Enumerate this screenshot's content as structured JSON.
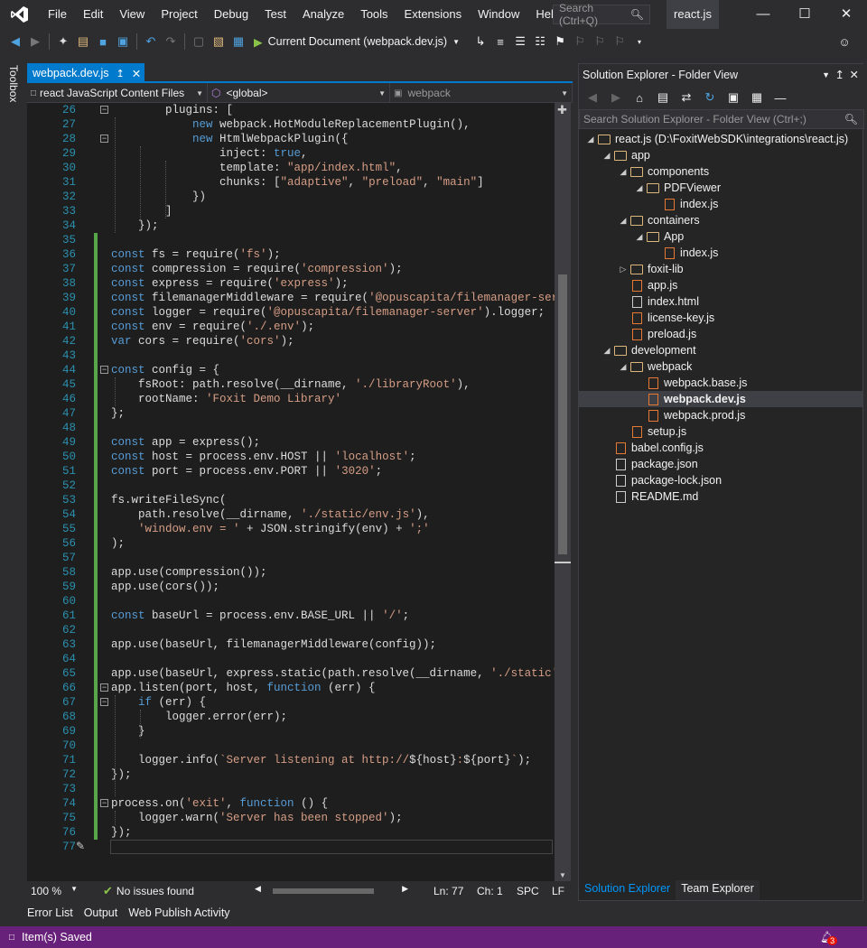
{
  "menu": {
    "items": [
      "File",
      "Edit",
      "View",
      "Project",
      "Debug",
      "Test",
      "Analyze",
      "Tools",
      "Extensions",
      "Window",
      "Help"
    ],
    "search_placeholder": "Search (Ctrl+Q)",
    "project_title": "react.js"
  },
  "toolbar": {
    "run_label": "Current Document (webpack.dev.js)"
  },
  "toolbox_label": "Toolbox",
  "editor": {
    "tab_label": "webpack.dev.js",
    "nav_project": "react JavaScript Content Files",
    "nav_scope": "<global>",
    "nav_member": "webpack",
    "lines": [
      {
        "n": "26",
        "t": "        plugins: ["
      },
      {
        "n": "27",
        "t": "            new webpack.HotModuleReplacementPlugin(),"
      },
      {
        "n": "28",
        "t": "            new HtmlWebpackPlugin({"
      },
      {
        "n": "29",
        "t": "                inject: true,"
      },
      {
        "n": "30",
        "t": "                template: \"app/index.html\","
      },
      {
        "n": "31",
        "t": "                chunks: [\"adaptive\", \"preload\", \"main\"]"
      },
      {
        "n": "32",
        "t": "            })"
      },
      {
        "n": "33",
        "t": "        ]"
      },
      {
        "n": "34",
        "t": "    });"
      },
      {
        "n": "35",
        "t": ""
      },
      {
        "n": "36",
        "t": "const fs = require('fs');"
      },
      {
        "n": "37",
        "t": "const compression = require('compression');"
      },
      {
        "n": "38",
        "t": "const express = require('express');"
      },
      {
        "n": "39",
        "t": "const filemanagerMiddleware = require('@opuscapita/filemanager-server'"
      },
      {
        "n": "40",
        "t": "const logger = require('@opuscapita/filemanager-server').logger;"
      },
      {
        "n": "41",
        "t": "const env = require('./.env');"
      },
      {
        "n": "42",
        "t": "var cors = require('cors');"
      },
      {
        "n": "43",
        "t": ""
      },
      {
        "n": "44",
        "t": "const config = {"
      },
      {
        "n": "45",
        "t": "    fsRoot: path.resolve(__dirname, './libraryRoot'),"
      },
      {
        "n": "46",
        "t": "    rootName: 'Foxit Demo Library'"
      },
      {
        "n": "47",
        "t": "};"
      },
      {
        "n": "48",
        "t": ""
      },
      {
        "n": "49",
        "t": "const app = express();"
      },
      {
        "n": "50",
        "t": "const host = process.env.HOST || 'localhost';"
      },
      {
        "n": "51",
        "t": "const port = process.env.PORT || '3020';"
      },
      {
        "n": "52",
        "t": ""
      },
      {
        "n": "53",
        "t": "fs.writeFileSync("
      },
      {
        "n": "54",
        "t": "    path.resolve(__dirname, './static/env.js'),"
      },
      {
        "n": "55",
        "t": "    'window.env = ' + JSON.stringify(env) + ';'"
      },
      {
        "n": "56",
        "t": ");"
      },
      {
        "n": "57",
        "t": ""
      },
      {
        "n": "58",
        "t": "app.use(compression());"
      },
      {
        "n": "59",
        "t": "app.use(cors());"
      },
      {
        "n": "60",
        "t": ""
      },
      {
        "n": "61",
        "t": "const baseUrl = process.env.BASE_URL || '/';"
      },
      {
        "n": "62",
        "t": ""
      },
      {
        "n": "63",
        "t": "app.use(baseUrl, filemanagerMiddleware(config));"
      },
      {
        "n": "64",
        "t": ""
      },
      {
        "n": "65",
        "t": "app.use(baseUrl, express.static(path.resolve(__dirname, './static')));"
      },
      {
        "n": "66",
        "t": "app.listen(port, host, function (err) {"
      },
      {
        "n": "67",
        "t": "    if (err) {"
      },
      {
        "n": "68",
        "t": "        logger.error(err);"
      },
      {
        "n": "69",
        "t": "    }"
      },
      {
        "n": "70",
        "t": ""
      },
      {
        "n": "71",
        "t": "    logger.info(`Server listening at http://${host}:${port}`);"
      },
      {
        "n": "72",
        "t": "});"
      },
      {
        "n": "73",
        "t": ""
      },
      {
        "n": "74",
        "t": "process.on('exit', function () {"
      },
      {
        "n": "75",
        "t": "    logger.warn('Server has been stopped');"
      },
      {
        "n": "76",
        "t": "});"
      },
      {
        "n": "77",
        "t": ""
      }
    ],
    "zoom": "100 %",
    "issues": "No issues found",
    "ln": "Ln: 77",
    "ch": "Ch: 1",
    "spc": "SPC",
    "lf": "LF"
  },
  "bottom_tabs": [
    "Error List",
    "Output",
    "Web Publish Activity"
  ],
  "status": {
    "message": "Item(s) Saved",
    "notif_count": "3"
  },
  "solution_explorer": {
    "title": "Solution Explorer - Folder View",
    "search_placeholder": "Search Solution Explorer - Folder View (Ctrl+;)",
    "nodes": [
      {
        "label": "react.js (D:\\FoxitWebSDK\\integrations\\react.js)",
        "level": 0,
        "exp": "open",
        "type": "folder"
      },
      {
        "label": "app",
        "level": 1,
        "exp": "open",
        "type": "folder"
      },
      {
        "label": "components",
        "level": 2,
        "exp": "open",
        "type": "folder"
      },
      {
        "label": "PDFViewer",
        "level": 3,
        "exp": "open",
        "type": "folder"
      },
      {
        "label": "index.js",
        "level": 4,
        "exp": "",
        "type": "js"
      },
      {
        "label": "containers",
        "level": 2,
        "exp": "open",
        "type": "folder"
      },
      {
        "label": "App",
        "level": 3,
        "exp": "open",
        "type": "folder"
      },
      {
        "label": "index.js",
        "level": 4,
        "exp": "",
        "type": "js"
      },
      {
        "label": "foxit-lib",
        "level": 2,
        "exp": "closed",
        "type": "folder"
      },
      {
        "label": "app.js",
        "level": 2,
        "exp": "",
        "type": "js"
      },
      {
        "label": "index.html",
        "level": 2,
        "exp": "",
        "type": "html"
      },
      {
        "label": "license-key.js",
        "level": 2,
        "exp": "",
        "type": "js"
      },
      {
        "label": "preload.js",
        "level": 2,
        "exp": "",
        "type": "js"
      },
      {
        "label": "development",
        "level": 1,
        "exp": "open",
        "type": "folder"
      },
      {
        "label": "webpack",
        "level": 2,
        "exp": "open",
        "type": "folder"
      },
      {
        "label": "webpack.base.js",
        "level": 3,
        "exp": "",
        "type": "js"
      },
      {
        "label": "webpack.dev.js",
        "level": 3,
        "exp": "",
        "type": "js",
        "selected": true
      },
      {
        "label": "webpack.prod.js",
        "level": 3,
        "exp": "",
        "type": "js"
      },
      {
        "label": "setup.js",
        "level": 2,
        "exp": "",
        "type": "js"
      },
      {
        "label": "babel.config.js",
        "level": 1,
        "exp": "",
        "type": "js"
      },
      {
        "label": "package.json",
        "level": 1,
        "exp": "",
        "type": "json"
      },
      {
        "label": "package-lock.json",
        "level": 1,
        "exp": "",
        "type": "json"
      },
      {
        "label": "README.md",
        "level": 1,
        "exp": "",
        "type": "md"
      }
    ],
    "tabs": [
      "Solution Explorer",
      "Team Explorer"
    ]
  },
  "colors": {
    "accent": "#007acc",
    "status_bar": "#68217a",
    "keyword": "#569cd6",
    "string": "#d69d85",
    "line_number": "#2b91af",
    "change_bar": "#57a64a"
  }
}
